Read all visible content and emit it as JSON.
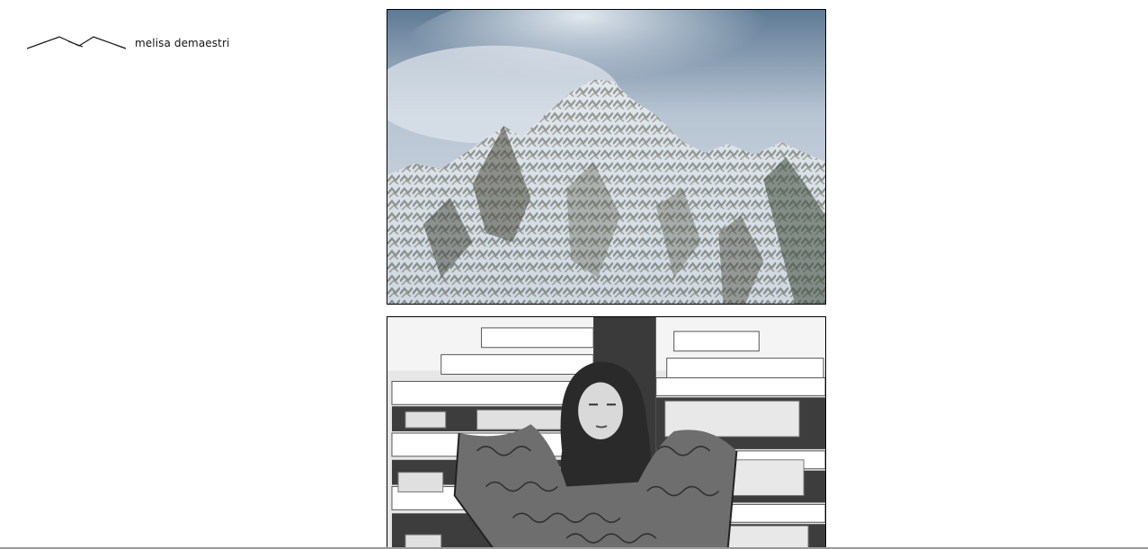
{
  "header": {
    "site_title": "melisa demaestri",
    "logo_icon": "mountain-outline-logo-icon"
  },
  "gallery": {
    "items": [
      {
        "subject": "snow-covered mountain peak under cloudy sky",
        "icon": "mountain-photo"
      },
      {
        "subject": "black and white portrait of a woman in front of apartment building",
        "icon": "portrait-photo"
      }
    ]
  },
  "colors": {
    "background": "#ffffff",
    "text": "#111111",
    "frame": "#000000"
  }
}
